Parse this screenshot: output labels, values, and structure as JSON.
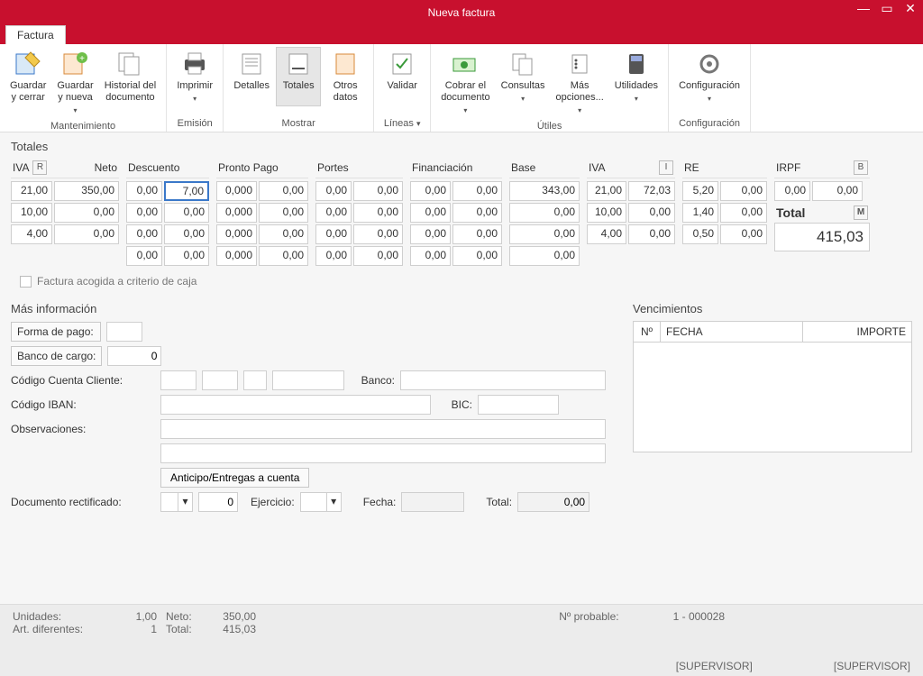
{
  "window": {
    "title": "Nueva factura"
  },
  "tabs": {
    "factura": "Factura"
  },
  "ribbon": {
    "mantenimiento": {
      "label": "Mantenimiento",
      "guardar_cerrar": "Guardar\ny cerrar",
      "guardar_nueva": "Guardar\ny nueva",
      "historial": "Historial del\ndocumento"
    },
    "emision": {
      "label": "Emisión",
      "imprimir": "Imprimir"
    },
    "mostrar": {
      "label": "Mostrar",
      "detalles": "Detalles",
      "totales": "Totales",
      "otros": "Otros\ndatos"
    },
    "lineas": {
      "label": "Líneas",
      "validar": "Validar"
    },
    "utiles": {
      "label": "Útiles",
      "cobrar": "Cobrar el\ndocumento",
      "consultas": "Consultas",
      "mas": "Más\nopciones...",
      "utilidades": "Utilidades"
    },
    "config": {
      "label": "Configuración",
      "configuracion": "Configuración"
    }
  },
  "sections": {
    "totales": "Totales",
    "masinfo": "Más información",
    "venc": "Vencimientos"
  },
  "headers": {
    "iva": "IVA",
    "r_tag": "R",
    "neto": "Neto",
    "descuento": "Descuento",
    "pronto": "Pronto Pago",
    "portes": "Portes",
    "financ": "Financiación",
    "base": "Base",
    "i_tag": "I",
    "re": "RE",
    "irpf": "IRPF",
    "b_tag": "B",
    "total": "Total",
    "m_tag": "M"
  },
  "totrows": [
    {
      "iva": "21,00",
      "neto": "350,00",
      "desc_p": "0,00",
      "desc_v": "7,00",
      "pp_p": "0,000",
      "pp_v": "0,00",
      "port_p": "0,00",
      "port_v": "0,00",
      "fin_p": "0,00",
      "fin_v": "0,00",
      "base": "343,00",
      "iva_p": "21,00",
      "iva_v": "72,03",
      "re_p": "5,20",
      "re_v": "0,00",
      "irpf_p": "0,00",
      "irpf_v": "0,00"
    },
    {
      "iva": "10,00",
      "neto": "0,00",
      "desc_p": "0,00",
      "desc_v": "0,00",
      "pp_p": "0,000",
      "pp_v": "0,00",
      "port_p": "0,00",
      "port_v": "0,00",
      "fin_p": "0,00",
      "fin_v": "0,00",
      "base": "0,00",
      "iva_p": "10,00",
      "iva_v": "0,00",
      "re_p": "1,40",
      "re_v": "0,00"
    },
    {
      "iva": "4,00",
      "neto": "0,00",
      "desc_p": "0,00",
      "desc_v": "0,00",
      "pp_p": "0,000",
      "pp_v": "0,00",
      "port_p": "0,00",
      "port_v": "0,00",
      "fin_p": "0,00",
      "fin_v": "0,00",
      "base": "0,00",
      "iva_p": "4,00",
      "iva_v": "0,00",
      "re_p": "0,50",
      "re_v": "0,00"
    },
    {
      "desc_p": "0,00",
      "desc_v": "0,00",
      "pp_p": "0,000",
      "pp_v": "0,00",
      "port_p": "0,00",
      "port_v": "0,00",
      "fin_p": "0,00",
      "fin_v": "0,00",
      "base": "0,00"
    }
  ],
  "total_value": "415,03",
  "chk_caja": "Factura acogida a criterio de caja",
  "form": {
    "forma_pago": "Forma de pago:",
    "banco_cargo": "Banco de cargo:",
    "banco_cargo_val": "0",
    "ccc": "Código Cuenta Cliente:",
    "banco": "Banco:",
    "iban": "Código IBAN:",
    "bic": "BIC:",
    "obs": "Observaciones:",
    "anticipo_btn": "Anticipo/Entregas a cuenta",
    "doc_rect": "Documento rectificado:",
    "doc_rect_num": "0",
    "ejercicio": "Ejercicio:",
    "fecha": "Fecha:",
    "total": "Total:",
    "total_val": "0,00"
  },
  "venc": {
    "n": "Nº",
    "fecha": "FECHA",
    "importe": "IMPORTE"
  },
  "footer": {
    "unidades": "Unidades:",
    "unidades_v": "1,00",
    "artdif": "Art. diferentes:",
    "artdif_v": "1",
    "neto": "Neto:",
    "neto_v": "350,00",
    "total": "Total:",
    "total_v": "415,03",
    "prob_l": "Nº probable:",
    "prob_v": "1 - 000028",
    "sup": "[SUPERVISOR]"
  }
}
